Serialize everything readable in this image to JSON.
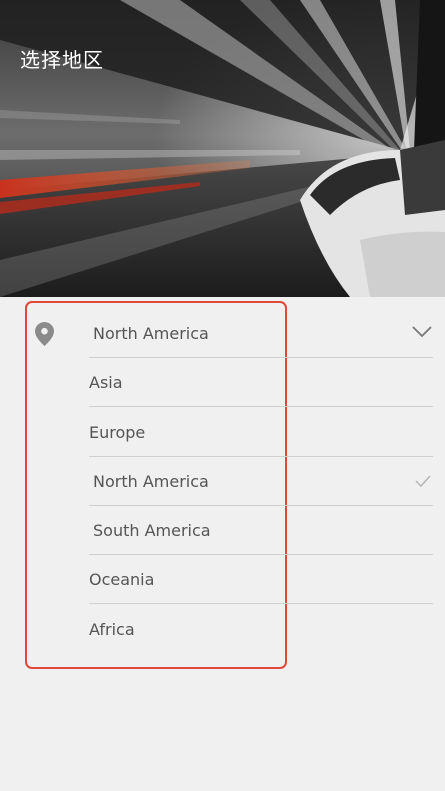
{
  "page": {
    "title": "选择地区"
  },
  "hero": {
    "image": "tunnel-car-motion-photo"
  },
  "region_selector": {
    "icon": "location-pin-icon",
    "selected": "North America",
    "expand_icon": "chevron-down-icon"
  },
  "region_options": [
    {
      "label": "Asia",
      "selected": false
    },
    {
      "label": "Europe",
      "selected": false
    },
    {
      "label": "North America",
      "selected": true
    },
    {
      "label": "South America",
      "selected": false
    },
    {
      "label": "Oceania",
      "selected": false
    },
    {
      "label": "Africa",
      "selected": false
    }
  ],
  "colors": {
    "background": "#f0f0f0",
    "highlight_border": "#e0483b",
    "text": "#555555",
    "divider": "#cfcfcf",
    "icon": "#8a8a8a"
  }
}
